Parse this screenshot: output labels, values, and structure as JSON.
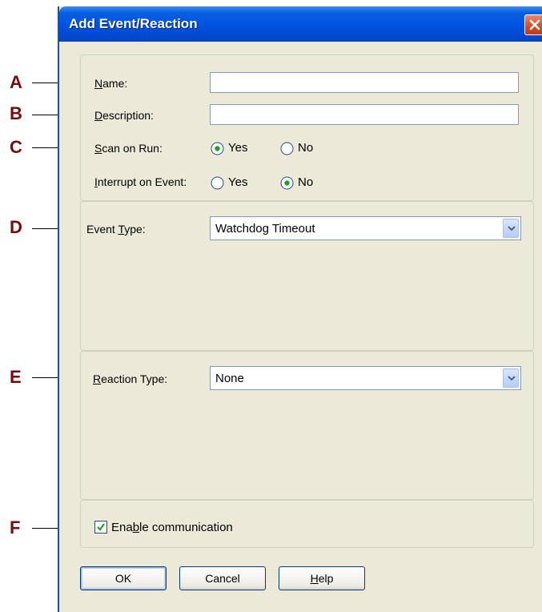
{
  "dialog": {
    "title": "Add Event/Reaction"
  },
  "callouts": [
    "A",
    "B",
    "C",
    "D",
    "E",
    "F"
  ],
  "fields": {
    "name": {
      "label_prefix": "",
      "label_accel": "N",
      "label_rest": "ame:",
      "value": ""
    },
    "description": {
      "label_prefix": "",
      "label_accel": "D",
      "label_rest": "escription:",
      "value": ""
    },
    "scan_on_run": {
      "label_prefix": "",
      "label_accel": "S",
      "label_rest": "can on Run:",
      "options": [
        "Yes",
        "No"
      ],
      "selected": "Yes"
    },
    "interrupt_on_event": {
      "label_prefix": "",
      "label_accel": "I",
      "label_rest": "nterrupt on Event:",
      "options": [
        "Yes",
        "No"
      ],
      "selected": "No"
    },
    "event_type": {
      "label_prefix": "Event ",
      "label_accel": "T",
      "label_rest": "ype:",
      "value": "Watchdog Timeout"
    },
    "reaction_type": {
      "label_prefix": "",
      "label_accel": "R",
      "label_rest": "eaction Type:",
      "value": "None"
    },
    "enable_communication": {
      "label_prefix": "Ena",
      "label_accel": "b",
      "label_rest": "le communication",
      "checked": true
    }
  },
  "buttons": {
    "ok": "OK",
    "cancel": "Cancel",
    "help_accel": "H",
    "help_rest": "elp"
  },
  "colors": {
    "titlebar": "#0054e3",
    "dialog_bg": "#ece9d8",
    "callout": "#7a0a0a",
    "radio_dot": "#21a121"
  },
  "icons": {
    "close": "close-icon",
    "dropdown": "chevron-down-icon",
    "checkmark": "checkmark-icon"
  }
}
